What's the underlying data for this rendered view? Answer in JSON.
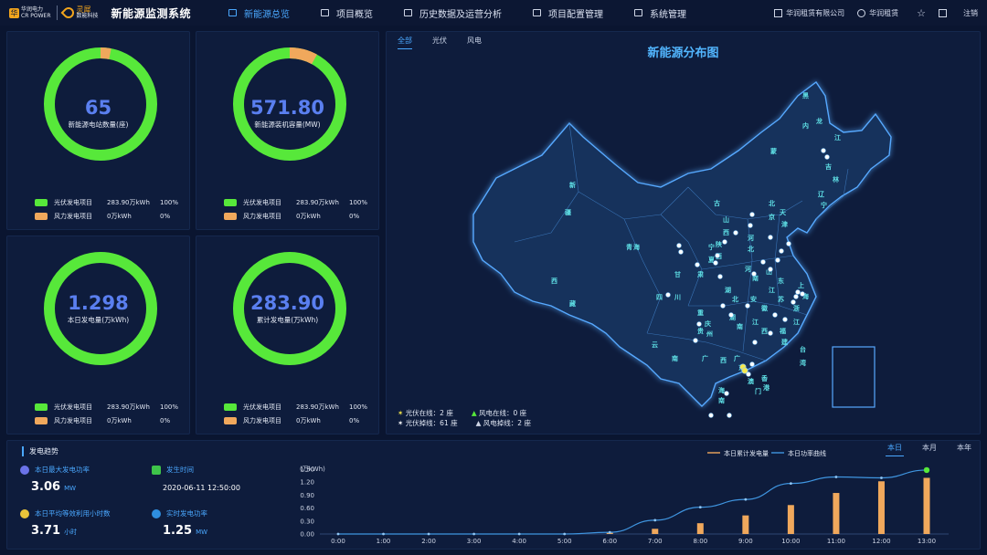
{
  "header": {
    "brand_main": "华润电力",
    "brand_sub": "CR POWER",
    "brand2": "灵犀",
    "brand2_sub": "数能科技",
    "system_title": "新能源监测系统",
    "nav": [
      {
        "label": "新能源总览",
        "active": true
      },
      {
        "label": "项目概览",
        "active": false
      },
      {
        "label": "历史数据及运营分析",
        "active": false
      },
      {
        "label": "项目配置管理",
        "active": false
      },
      {
        "label": "系统管理",
        "active": false
      }
    ],
    "company": "华润租赁有限公司",
    "user": "华润租赁",
    "logout": "注销"
  },
  "kpis": [
    {
      "value": "65",
      "label": "新能源电站数量(座)",
      "wind_share": 0.03,
      "rows": [
        {
          "name": "光伏发电项目",
          "amount": "283.90万kWh",
          "pct": "100%"
        },
        {
          "name": "风力发电项目",
          "amount": "0万kWh",
          "pct": "0%"
        }
      ]
    },
    {
      "value": "571.80",
      "label": "新能源装机容量(MW)",
      "wind_share": 0.08,
      "rows": [
        {
          "name": "光伏发电项目",
          "amount": "283.90万kWh",
          "pct": "100%"
        },
        {
          "name": "风力发电项目",
          "amount": "0万kWh",
          "pct": "0%"
        }
      ]
    },
    {
      "value": "1.298",
      "label": "本日发电量(万kWh)",
      "wind_share": 0,
      "rows": [
        {
          "name": "光伏发电项目",
          "amount": "283.90万kWh",
          "pct": "100%"
        },
        {
          "name": "风力发电项目",
          "amount": "0万kWh",
          "pct": "0%"
        }
      ]
    },
    {
      "value": "283.90",
      "label": "累计发电量(万kWh)",
      "wind_share": 0,
      "rows": [
        {
          "name": "光伏发电项目",
          "amount": "283.90万kWh",
          "pct": "100%"
        },
        {
          "name": "风力发电项目",
          "amount": "0万kWh",
          "pct": "0%"
        }
      ]
    }
  ],
  "colors": {
    "solar": "#57e83a",
    "wind": "#f0a85c",
    "accent": "#4aa8ff",
    "line": "#3f95e0"
  },
  "map": {
    "tabs": [
      {
        "label": "全部",
        "active": true
      },
      {
        "label": "光伏",
        "active": false
      },
      {
        "label": "风电",
        "active": false
      }
    ],
    "title": "新能源分布图",
    "legend": {
      "solar_online": "光伏在线：2 座",
      "wind_online": "风电在线：0 座",
      "solar_offline": "光伏掉线：61 座",
      "wind_offline": "风电掉线：2 座"
    },
    "provinces": [
      "黑",
      "龙",
      "江",
      "吉",
      "林",
      "内",
      "蒙",
      "古",
      "辽",
      "宁",
      "新",
      "疆",
      "西",
      "藏",
      "青",
      "海",
      "甘",
      "肃",
      "宁",
      "夏",
      "山",
      "西",
      "陕",
      "西",
      "河",
      "北",
      "北",
      "京",
      "天",
      "津",
      "山",
      "东",
      "河",
      "南",
      "四",
      "川",
      "重",
      "庆",
      "湖",
      "北",
      "安",
      "徽",
      "江",
      "苏",
      "上",
      "海",
      "浙",
      "江",
      "贵",
      "州",
      "云",
      "南",
      "湖",
      "南",
      "江",
      "西",
      "福",
      "建",
      "广",
      "西",
      "广",
      "东",
      "台",
      "湾",
      "海",
      "南",
      "香",
      "港",
      "澳",
      "门"
    ]
  },
  "trend": {
    "title": "发电趋势",
    "metrics": [
      {
        "label": "本日最大发电功率",
        "value": "3.06",
        "unit": "MW"
      },
      {
        "label": "发生时间",
        "value": "2020-06-11 12:50:00"
      },
      {
        "label": "本日平均等效利用小时数",
        "value": "3.71",
        "unit": "小时"
      },
      {
        "label": "实时发电功率",
        "value": "1.25",
        "unit": "MW"
      }
    ],
    "periods": [
      {
        "label": "本日",
        "active": true
      },
      {
        "label": "本月",
        "active": false
      },
      {
        "label": "本年",
        "active": false
      }
    ]
  },
  "chart_data": {
    "type": "bar",
    "ylabel": "(万kWh)",
    "ylim": [
      0,
      1.5
    ],
    "yticks": [
      "0.00",
      "0.30",
      "0.60",
      "0.90",
      "1.20",
      "1.50"
    ],
    "categories": [
      "0:00",
      "1:00",
      "2:00",
      "3:00",
      "4:00",
      "5:00",
      "6:00",
      "7:00",
      "8:00",
      "9:00",
      "10:00",
      "11:00",
      "12:00",
      "13:00"
    ],
    "series": [
      {
        "name": "本日累计发电量",
        "type": "bar",
        "values": [
          0,
          0,
          0,
          0,
          0,
          0,
          0.03,
          0.12,
          0.25,
          0.43,
          0.67,
          0.95,
          1.22,
          1.3
        ]
      },
      {
        "name": "本日功率曲线",
        "type": "line",
        "values": [
          0,
          0,
          0,
          0,
          0,
          0,
          0.04,
          0.32,
          0.62,
          0.8,
          1.17,
          1.32,
          1.3,
          1.48
        ]
      }
    ],
    "legend_position": "top-right",
    "grid": false
  }
}
